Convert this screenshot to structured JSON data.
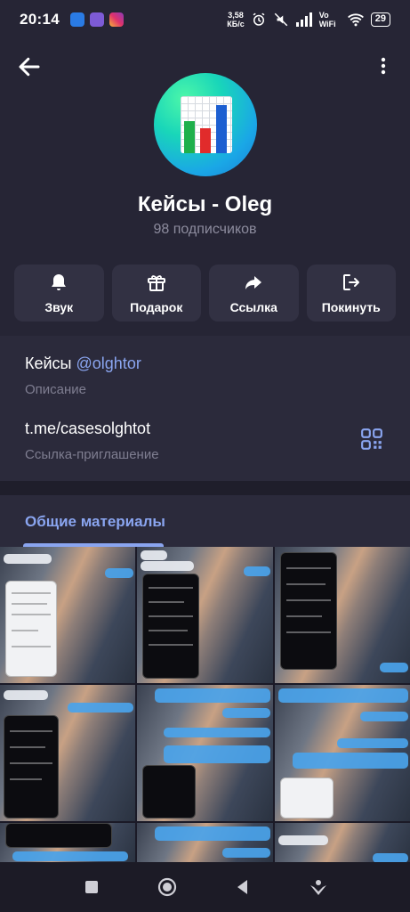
{
  "status_bar": {
    "time": "20:14",
    "speed_value": "3,58",
    "speed_unit": "КБ/с",
    "network": "Vo WiFi",
    "battery": "29"
  },
  "channel": {
    "title": "Кейсы - Oleg",
    "subscribers": "98 подписчиков"
  },
  "actions": [
    {
      "label": "Звук",
      "icon": "bell-icon"
    },
    {
      "label": "Подарок",
      "icon": "gift-icon"
    },
    {
      "label": "Ссылка",
      "icon": "share-icon"
    },
    {
      "label": "Покинуть",
      "icon": "leave-icon"
    }
  ],
  "info": {
    "description_text": "Кейсы",
    "description_mention": "@olghtor",
    "description_label": "Описание",
    "link": "t.me/casesolghtot",
    "link_label": "Ссылка-приглашение"
  },
  "tabs": {
    "active": "Общие материалы"
  },
  "media": {
    "count_visible": 9
  },
  "colors": {
    "accent": "#8aa5f0",
    "background": "#262535",
    "button": "#323143"
  }
}
